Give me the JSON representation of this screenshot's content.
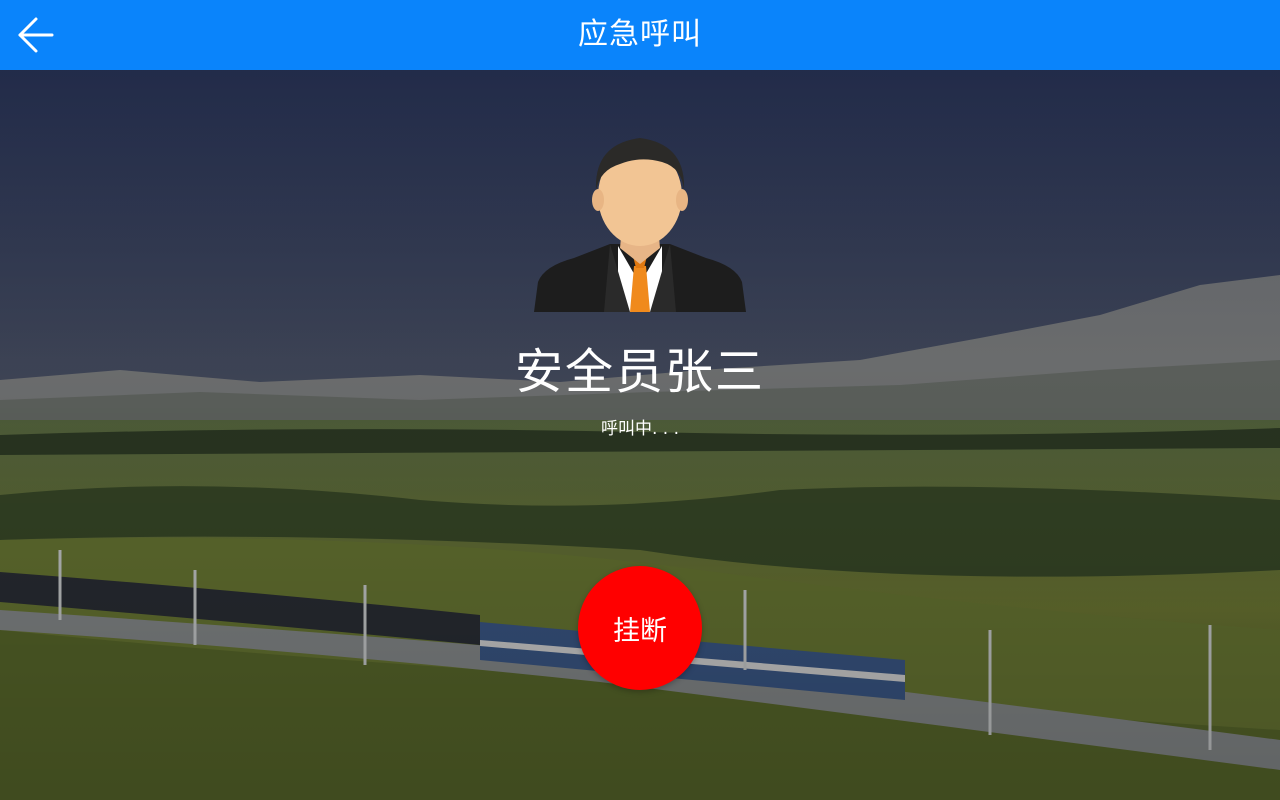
{
  "header": {
    "title": "应急呼叫",
    "back_icon": "arrow-left-icon"
  },
  "caller": {
    "name": "安全员张三",
    "status": "呼叫中. . .",
    "avatar_icon": "businessman-avatar-icon"
  },
  "actions": {
    "hangup_label": "挂断"
  },
  "colors": {
    "header_bg": "#0a84fb",
    "hangup_bg": "#ff0000",
    "text": "#ffffff"
  }
}
